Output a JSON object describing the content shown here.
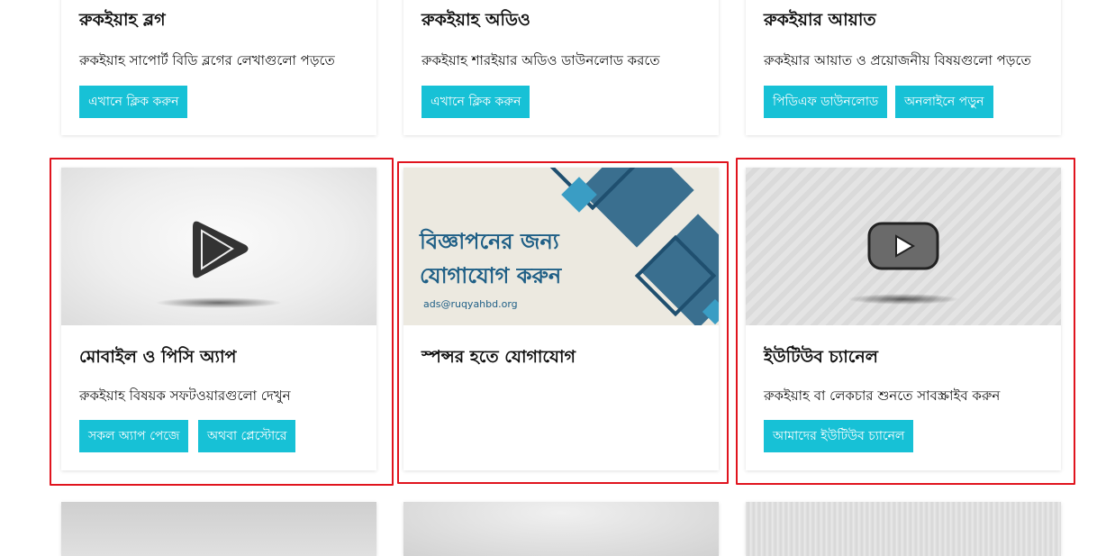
{
  "top_cards": [
    {
      "title": "রুকইয়াহ ব্লগ",
      "desc": "রুকইয়াহ সাপোর্ট বিডি ব্লগের লেখাগুলো পড়তে",
      "buttons": [
        "এখানে ক্লিক করুন"
      ]
    },
    {
      "title": "রুকইয়াহ অডিও",
      "desc": "রুকইয়াহ শারইয়ার অডিও ডাউনলোড করতে",
      "buttons": [
        "এখানে ক্লিক করুন"
      ]
    },
    {
      "title": "রুকইয়ার আয়াত",
      "desc": "রুকইয়ার আয়াত ও প্রয়োজনীয় বিষয়গুলো পড়তে",
      "buttons": [
        "পিডিএফ ডাউনলোড",
        "অনলাইনে পড়ুন"
      ]
    }
  ],
  "middle_cards": [
    {
      "title": "মোবাইল ও পিসি অ্যাপ",
      "desc": "রুকইয়াহ বিষয়ক সফটওয়ারগুলো দেখুন",
      "buttons": [
        "সকল অ্যাপ পেজে",
        "অথবা প্লেস্টোরে"
      ],
      "image_icon": "play-store-icon"
    },
    {
      "title": "স্পন্সর হতে যোগাযোগ",
      "desc": "",
      "buttons": [],
      "banner": {
        "line1": "বিজ্ঞাপনের জন্য",
        "line2": "যোগাযোগ করুন",
        "email": "ads@ruqyahbd.org"
      }
    },
    {
      "title": "ইউটিউব চ্যানেল",
      "desc": "রুকইয়াহ বা লেকচার শুনতে সাবস্ক্রাইব করুন",
      "buttons": [
        "আমাদের ইউটিউব চ্যানেল"
      ],
      "image_icon": "youtube-icon"
    }
  ],
  "colors": {
    "button": "#17c1d6",
    "highlight": "#e0141e",
    "banner_text": "#1f5f86",
    "banner_shape": "#3a6f8f"
  }
}
